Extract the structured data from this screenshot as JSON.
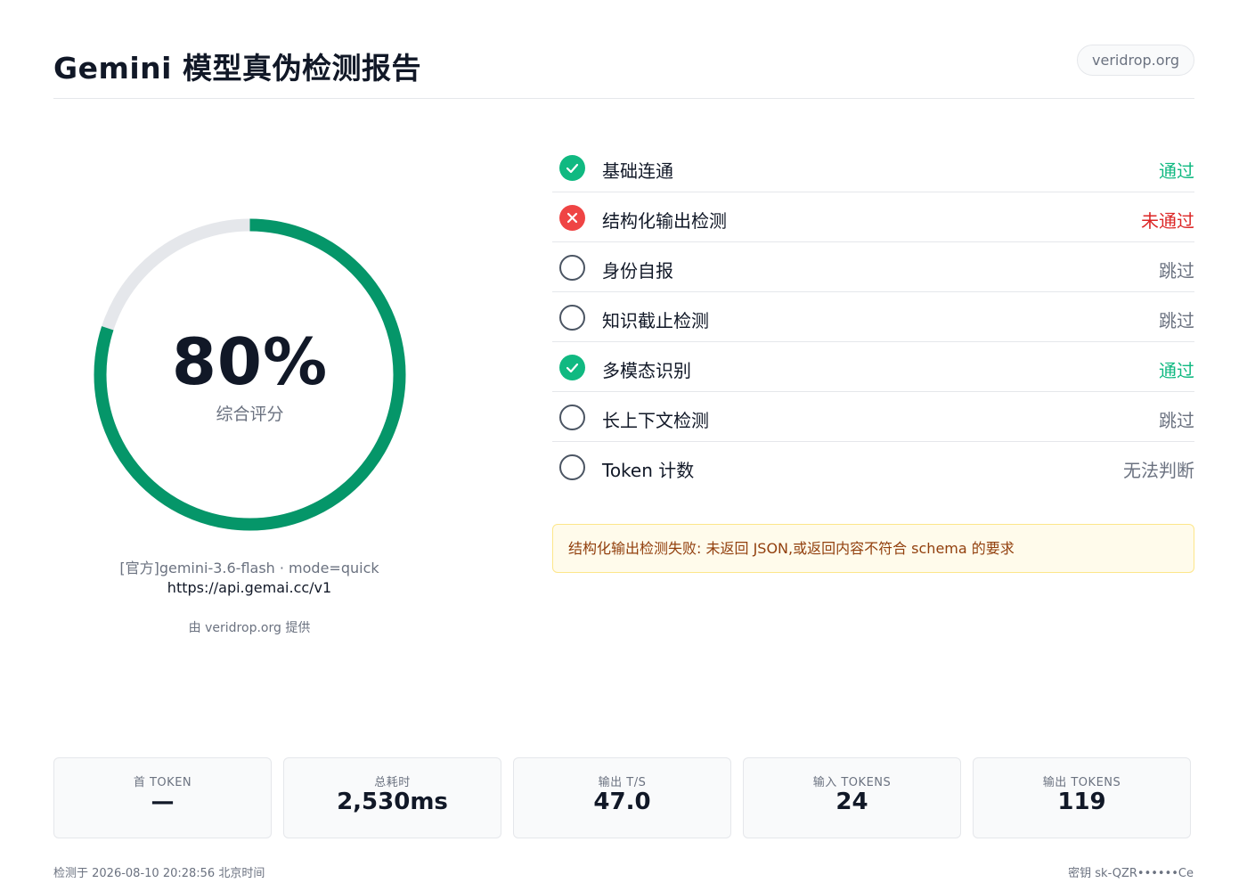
{
  "header": {
    "title": "Gemini 模型真伪检测报告",
    "domain": "veridrop.org"
  },
  "score": {
    "value": "80%",
    "fraction": 0.8,
    "label": "综合评分",
    "ring_color": "#059669"
  },
  "model": {
    "line": "[官方]gemini-3.6-flash · mode=quick",
    "url": "https://api.gemai.cc/v1",
    "credit": "由 veridrop.org 提供"
  },
  "checks": [
    {
      "label": "基础连通",
      "status": "通过",
      "state": "pass"
    },
    {
      "label": "结构化输出检测",
      "status": "未通过",
      "state": "fail"
    },
    {
      "label": "身份自报",
      "status": "跳过",
      "state": "none"
    },
    {
      "label": "知识截止检测",
      "status": "跳过",
      "state": "none"
    },
    {
      "label": "多模态识别",
      "status": "通过",
      "state": "pass"
    },
    {
      "label": "长上下文检测",
      "status": "跳过",
      "state": "none"
    },
    {
      "label": "Token 计数",
      "status": "无法判断",
      "state": "none"
    }
  ],
  "notice": "结构化输出检测失败: 未返回 JSON,或返回内容不符合 schema 的要求",
  "stats": [
    {
      "label": "首 TOKEN",
      "value": "—"
    },
    {
      "label": "总耗时",
      "value": "2,530ms"
    },
    {
      "label": "输出 T/S",
      "value": "47.0"
    },
    {
      "label": "输入 TOKENS",
      "value": "24"
    },
    {
      "label": "输出 TOKENS",
      "value": "119"
    }
  ],
  "footer": {
    "left": "检测于 2026-08-10 20:28:56 北京时间",
    "right": "密钥 sk-QZR••••••Ce"
  },
  "colors": {
    "pass": "#10b981",
    "fail": "#ef4444",
    "accent": "#059669",
    "notice_bg": "#fffbeb",
    "notice_text": "#92400e"
  }
}
